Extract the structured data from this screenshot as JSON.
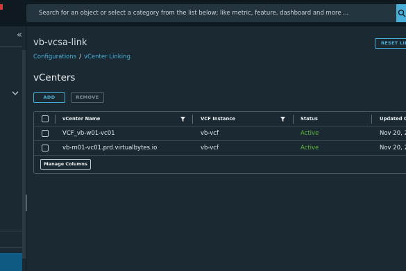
{
  "search": {
    "placeholder": "Search for an object or select a category from the list below; like metric, feature, dashboard and more ..."
  },
  "sidebar": {
    "collapse_label": "«"
  },
  "page": {
    "title": "vb-vcsa-link",
    "reset_label": "RESET LINK",
    "breadcrumb": [
      "Configurations",
      "/",
      "vCenter Linking"
    ]
  },
  "section": {
    "title": "vCenters",
    "add_label": "ADD",
    "remove_label": "REMOVE"
  },
  "table": {
    "columns": [
      "vCenter Name",
      "VCF Instance",
      "Status",
      "Updated On"
    ],
    "rows": [
      [
        "VCF_vb-w01-vc01",
        "vb-vcf",
        "Active",
        "Nov 20, 2"
      ],
      [
        "vb-m01-vc01.prd.virtualbytes.io",
        "vb-vcf",
        "Active",
        "Nov 20, 2"
      ]
    ],
    "manage_columns_label": "Manage Columns"
  },
  "colors": {
    "accent": "#49afd9",
    "active": "#5ebb3a",
    "background": "#1b2a32"
  }
}
